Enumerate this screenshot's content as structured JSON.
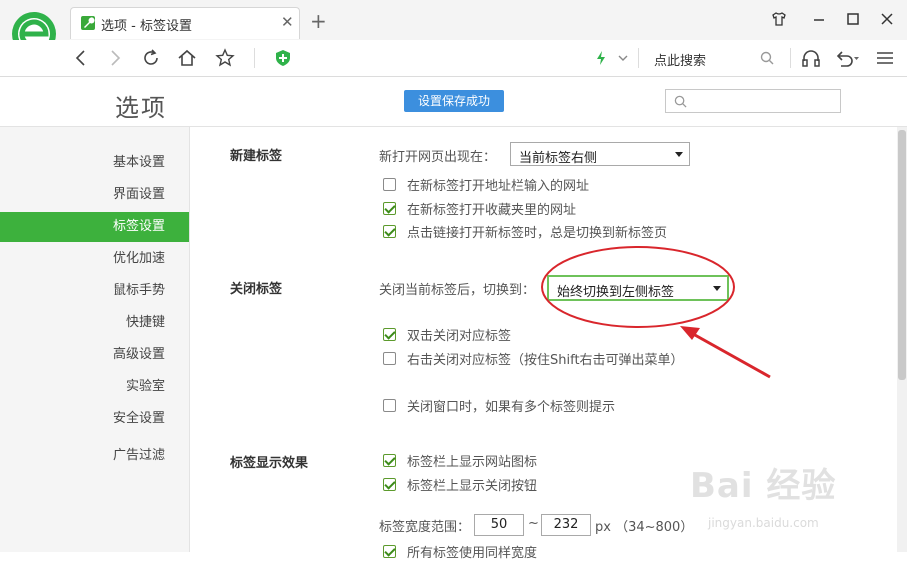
{
  "browser": {
    "tab_title": "选项 - 标签设置",
    "tab_close": "✕",
    "new_tab": "+",
    "search_placeholder": "点此搜索",
    "accent_color": "#3db13d"
  },
  "page": {
    "title": "选项",
    "save_badge": "设置保存成功"
  },
  "sidebar": {
    "items": [
      {
        "label": "基本设置"
      },
      {
        "label": "界面设置"
      },
      {
        "label": "标签设置",
        "active": true
      },
      {
        "label": "优化加速"
      },
      {
        "label": "鼠标手势"
      },
      {
        "label": "快捷键"
      },
      {
        "label": "高级设置"
      },
      {
        "label": "实验室"
      },
      {
        "label": "安全设置"
      },
      {
        "label": "广告过滤"
      }
    ]
  },
  "new_tab_section": {
    "title": "新建标签",
    "open_position_label": "新打开网页出现在：",
    "open_position_value": "当前标签右侧",
    "options": [
      {
        "label": "在新标签打开地址栏输入的网址",
        "checked": false
      },
      {
        "label": "在新标签打开收藏夹里的网址",
        "checked": true
      },
      {
        "label": "点击链接打开新标签时，总是切换到新标签页",
        "checked": true
      }
    ]
  },
  "close_tab_section": {
    "title": "关闭标签",
    "switch_label": "关闭当前标签后，切换到：",
    "switch_value": "始终切换到左侧标签",
    "options": [
      {
        "label": "双击关闭对应标签",
        "checked": true
      },
      {
        "label": "右击关闭对应标签（按住Shift右击可弹出菜单）",
        "checked": false
      },
      {
        "label": "关闭窗口时，如果有多个标签则提示",
        "checked": false
      }
    ]
  },
  "tab_display_section": {
    "title": "标签显示效果",
    "options": [
      {
        "label": "标签栏上显示网站图标",
        "checked": true
      },
      {
        "label": "标签栏上显示关闭按钮",
        "checked": true
      }
    ],
    "width_label": "标签宽度范围：",
    "width_min": "50",
    "width_sep": "~",
    "width_max": "232",
    "width_unit": "px （34~800）",
    "next_option": "所有标签使用同样宽度"
  },
  "watermark": {
    "text": "Bai 经验",
    "url": "jingyan.baidu.com"
  }
}
